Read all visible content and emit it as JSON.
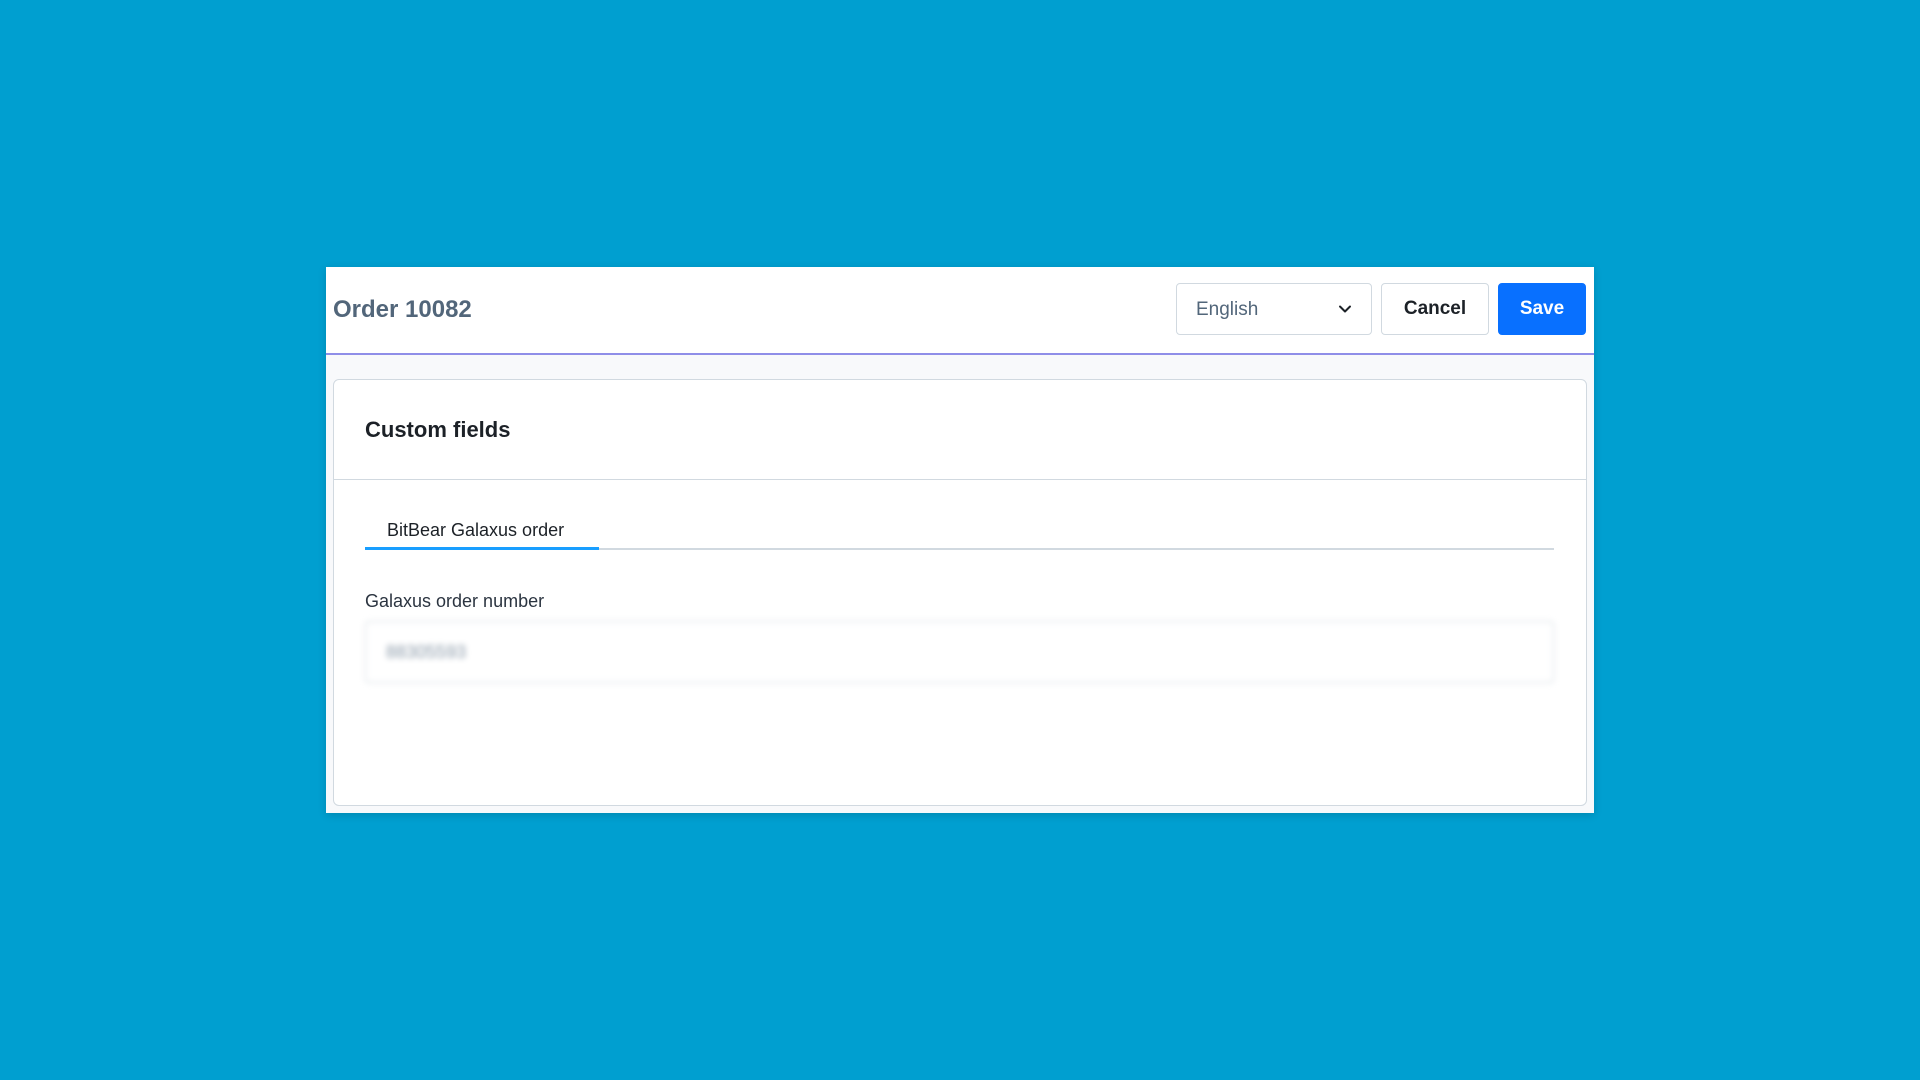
{
  "colors": {
    "backdrop": "#009fd0",
    "title": "#52667a",
    "save_button": "#0870ff"
  },
  "modal": {
    "title": "Order 10082",
    "language_select": {
      "value": "English",
      "icon": "chevron-down-icon"
    },
    "cancel_label": "Cancel",
    "save_label": "Save"
  },
  "card": {
    "title": "Custom fields",
    "tabs": [
      {
        "label": "BitBear Galaxus order",
        "active": true
      }
    ],
    "fields": [
      {
        "label": "Galaxus order number",
        "value": "88305593"
      }
    ]
  }
}
